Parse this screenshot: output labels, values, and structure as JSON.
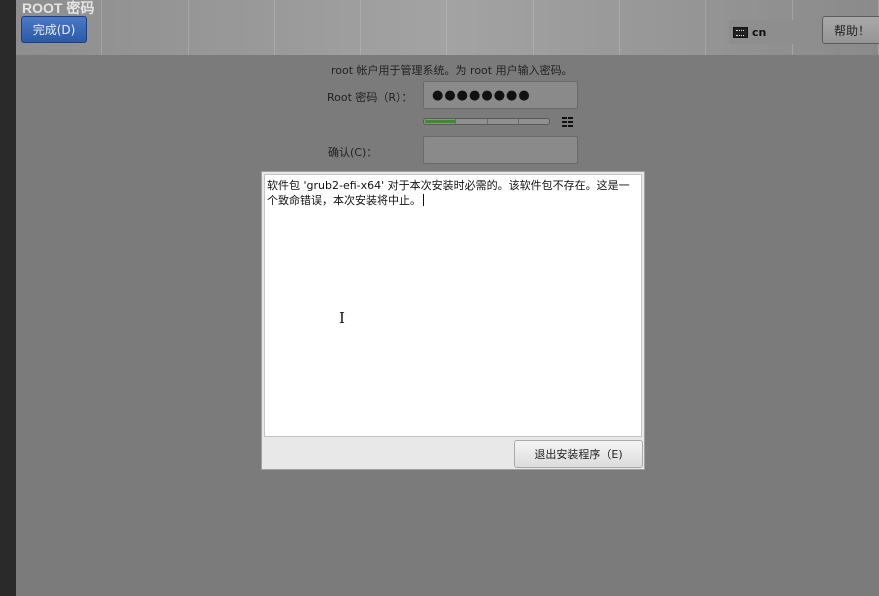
{
  "header": {
    "title": "ROOT 密码",
    "done_label": "完成(D)",
    "keyboard_layout": "cn",
    "help_label": "帮助！"
  },
  "form": {
    "description": "root 帐户用于管理系统。为 root 用户输入密码。",
    "root_password_label": "Root 密码（R）：",
    "root_password_value": "●●●●●●●●",
    "confirm_label": "确认(C)：",
    "confirm_value": "",
    "strength_fraction": 0.25
  },
  "dialog": {
    "message": "软件包 'grub2-efi-x64' 对于本次安装时必需的。该软件包不存在。这是一个致命错误，本次安装将中止。",
    "quit_label": "退出安装程序（E)"
  },
  "colors": {
    "accent": "#2c5aa6",
    "strength_bar": "#3f8a2f",
    "background": "#7b7b7b"
  }
}
